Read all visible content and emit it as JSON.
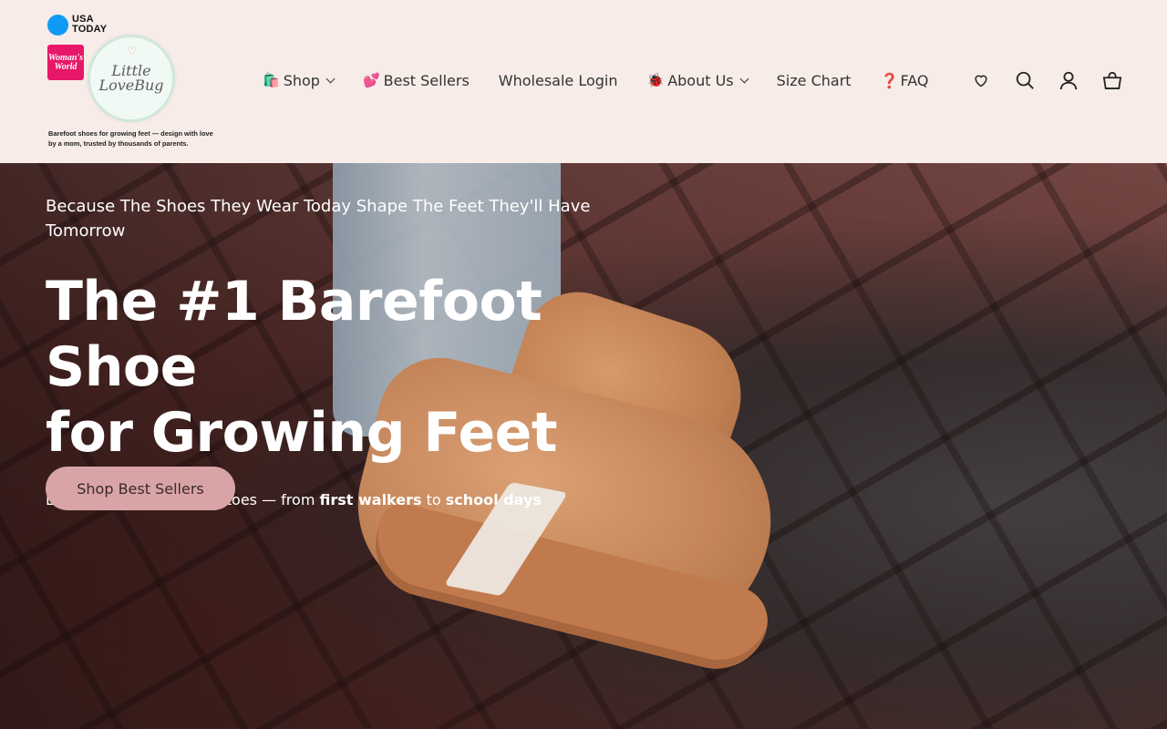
{
  "brand": {
    "usa_today": "USA TODAY",
    "womans_world": "Woman's World",
    "logo_text": "Little LoveBug",
    "tagline": "Barefoot shoes for growing feet — design with love by a mom, trusted by thousands of parents."
  },
  "nav": {
    "items": [
      {
        "emoji": "🛍️",
        "label": "Shop",
        "has_dropdown": true
      },
      {
        "emoji": "💕",
        "label": "Best Sellers",
        "has_dropdown": false
      },
      {
        "emoji": "",
        "label": "Wholesale Login",
        "has_dropdown": false
      },
      {
        "emoji": "🐞",
        "label": "About Us",
        "has_dropdown": true
      },
      {
        "emoji": "",
        "label": "Size Chart",
        "has_dropdown": false
      },
      {
        "emoji": "❓",
        "label": "FAQ",
        "has_dropdown": false
      }
    ]
  },
  "header_icons": [
    "heart-icon",
    "search-icon",
    "account-icon",
    "cart-icon"
  ],
  "hero": {
    "eyebrow": "Because The Shoes They Wear Today Shape The Feet They'll Have Tomorrow",
    "title_line1": "The #1 Barefoot Shoe",
    "title_line2": "for Growing Feet",
    "sub_prefix": "Loved by 100,000+ tiny toes — from ",
    "sub_bold1": "first walkers",
    "sub_mid": " to ",
    "sub_bold2": "school days",
    "cta_label": "Shop Best Sellers"
  },
  "colors": {
    "header_bg": "#f7ece8",
    "cta_bg": "#d9a4a6",
    "usa_today_blue": "#0f9bf5",
    "womans_world_pink": "#e8176a"
  }
}
